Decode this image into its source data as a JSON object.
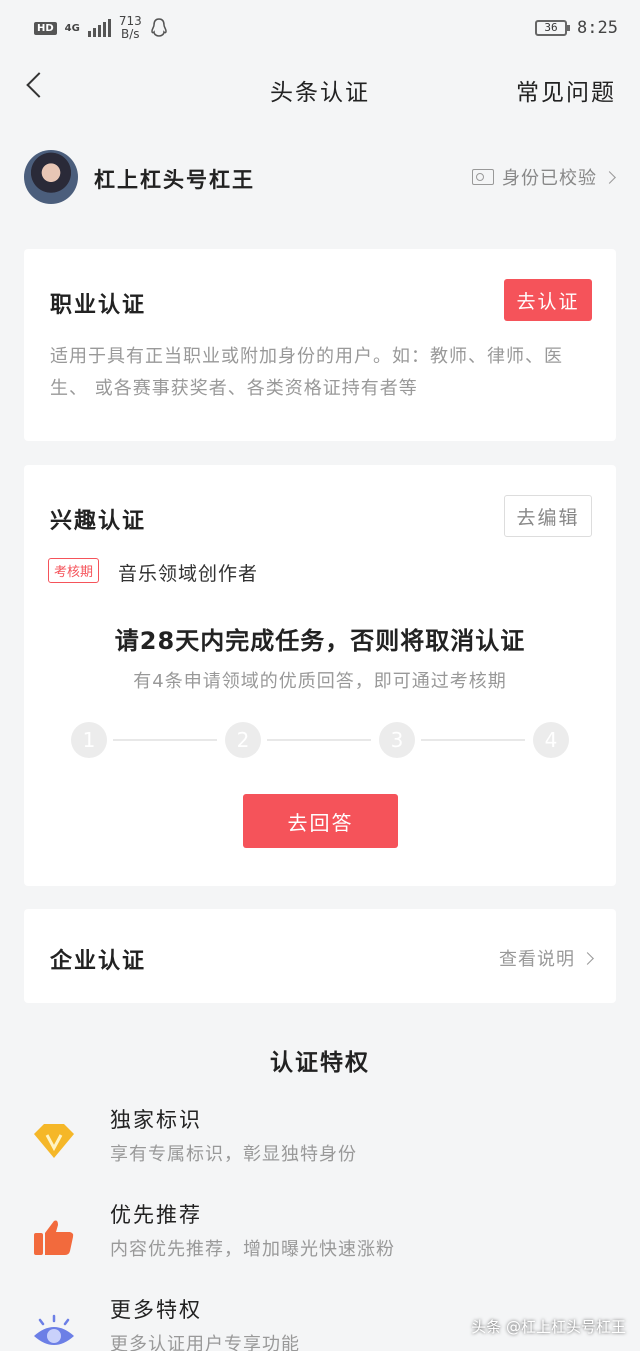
{
  "status_bar": {
    "network": "4G",
    "speed_value": "713",
    "speed_unit": "B/s",
    "battery": "36",
    "time": "8:25"
  },
  "navbar": {
    "title": "头条认证",
    "right_link": "常见问题"
  },
  "profile": {
    "username": "杠上杠头号杠王",
    "verify_status": "身份已校验"
  },
  "professional": {
    "title": "职业认证",
    "button": "去认证",
    "description": "适用于具有正当职业或附加身份的用户。如：教师、律师、医生、 或各赛事获奖者、各类资格证持有者等"
  },
  "interest": {
    "title": "兴趣认证",
    "button": "去编辑",
    "tag": "考核期",
    "domain": "音乐领域创作者",
    "task_main": "请28天内完成任务，否则将取消认证",
    "task_sub": "有4条申请领域的优质回答，即可通过考核期",
    "steps": [
      "1",
      "2",
      "3",
      "4"
    ],
    "answer_button": "去回答"
  },
  "enterprise": {
    "title": "企业认证",
    "link": "查看说明"
  },
  "privileges": {
    "title": "认证特权",
    "items": [
      {
        "icon": "diamond-v-icon",
        "title": "独家标识",
        "desc": "享有专属标识，彰显独特身份"
      },
      {
        "icon": "thumbs-up-icon",
        "title": "优先推荐",
        "desc": "内容优先推荐，增加曝光快速涨粉"
      },
      {
        "icon": "eye-icon",
        "title": "更多特权",
        "desc": "更多认证用户专享功能"
      }
    ]
  },
  "watermark": "头条 @杠上杠头号杠王",
  "colors": {
    "accent": "#f5535a",
    "background": "#f4f5f6"
  }
}
